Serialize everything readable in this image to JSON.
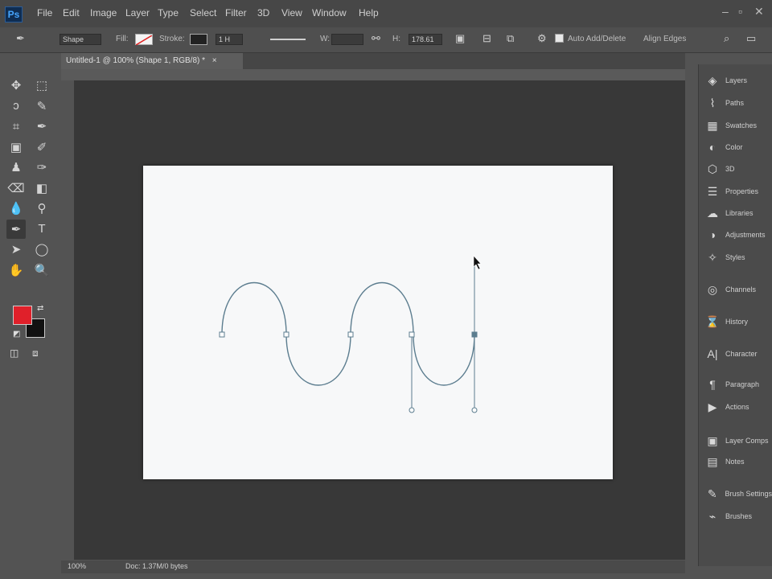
{
  "app": {
    "logo": "Ps"
  },
  "menu": [
    "File",
    "Edit",
    "Image",
    "Layer",
    "Type",
    "Select",
    "Filter",
    "3D",
    "View",
    "Window",
    "Help"
  ],
  "window_controls": {
    "minimize": "–",
    "restore": "▫",
    "close": "✕"
  },
  "options_bar": {
    "mode": "Shape",
    "fill_label": "Fill:",
    "stroke_label": "Stroke:",
    "stroke_width": "1 H",
    "width_label": "W:",
    "height_label": "H:",
    "extra_value": "178.61",
    "auto_add_delete": "Auto Add/Delete",
    "align_edges": "Align Edges"
  },
  "document_tab": {
    "title": "Untitled-1 @ 100% (Shape 1, RGB/8) *",
    "close": "×"
  },
  "tools": [
    {
      "name": "move-tool",
      "glyph": "✥"
    },
    {
      "name": "marquee-tool",
      "glyph": "⬚"
    },
    {
      "name": "lasso-tool",
      "glyph": "ↄ"
    },
    {
      "name": "quick-select-tool",
      "glyph": "✎"
    },
    {
      "name": "crop-tool",
      "glyph": "⌗"
    },
    {
      "name": "eyedropper-tool",
      "glyph": "✒"
    },
    {
      "name": "frame-tool",
      "glyph": "▣"
    },
    {
      "name": "brush-tool",
      "glyph": "✐"
    },
    {
      "name": "stamp-tool",
      "glyph": "♟"
    },
    {
      "name": "history-brush-tool",
      "glyph": "✑"
    },
    {
      "name": "eraser-tool",
      "glyph": "⌫"
    },
    {
      "name": "gradient-tool",
      "glyph": "◧"
    },
    {
      "name": "blur-tool",
      "glyph": "💧"
    },
    {
      "name": "dodge-tool",
      "glyph": "⚲"
    },
    {
      "name": "pen-tool",
      "glyph": "✒"
    },
    {
      "name": "type-tool",
      "glyph": "T"
    },
    {
      "name": "path-select-tool",
      "glyph": "➤"
    },
    {
      "name": "ellipse-tool",
      "glyph": "◯"
    },
    {
      "name": "hand-tool",
      "glyph": "✋"
    },
    {
      "name": "zoom-tool",
      "glyph": "🔍"
    }
  ],
  "colors": {
    "foreground": "#e0202a",
    "background": "#111111",
    "workspace": "#383838",
    "path": "#5c7d8f"
  },
  "panels": [
    {
      "icon": "layers-icon",
      "glyph": "◈",
      "label": "Layers"
    },
    {
      "icon": "paths-icon",
      "glyph": "⌇",
      "label": "Paths"
    },
    {
      "icon": "swatches-icon",
      "glyph": "▦",
      "label": "Swatches"
    },
    {
      "icon": "color-icon",
      "glyph": "◐",
      "label": "Color"
    },
    {
      "icon": "3d-icon",
      "glyph": "⬡",
      "label": "3D"
    },
    {
      "icon": "properties-icon",
      "glyph": "☰",
      "label": "Properties"
    },
    {
      "icon": "libraries-icon",
      "glyph": "☁",
      "label": "Libraries"
    },
    {
      "icon": "adjustments-icon",
      "glyph": "◑",
      "label": "Adjustments"
    },
    {
      "icon": "styles-icon",
      "glyph": "✧",
      "label": "Styles"
    },
    {
      "icon": "channels-icon",
      "glyph": "◎",
      "label": "Channels"
    },
    {
      "icon": "history-icon",
      "glyph": "⌛",
      "label": "History"
    },
    {
      "icon": "character-icon",
      "glyph": "A|",
      "label": "Character"
    },
    {
      "icon": "paragraph-icon",
      "glyph": "¶",
      "label": "Paragraph"
    },
    {
      "icon": "actions-icon",
      "glyph": "▶",
      "label": "Actions"
    },
    {
      "icon": "layer-comps-icon",
      "glyph": "▣",
      "label": "Layer Comps"
    },
    {
      "icon": "notes-icon",
      "glyph": "▤",
      "label": "Notes"
    },
    {
      "icon": "brush-settings-icon",
      "glyph": "✎",
      "label": "Brush Settings"
    },
    {
      "icon": "brushes-icon",
      "glyph": "⌁",
      "label": "Brushes"
    }
  ],
  "status_bar": {
    "zoom": "100%",
    "doc_info": "Doc: 1.37M/0 bytes"
  }
}
